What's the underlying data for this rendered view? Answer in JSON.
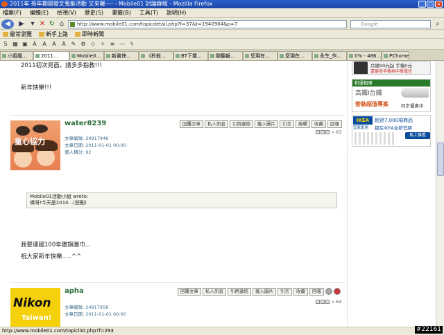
{
  "window": {
    "title": "2011年 新年期間發文蒐集活動 又來囉---- - Mobile01 討論群組 - Mozilla Firefox"
  },
  "menu": [
    "檔案(F)",
    "編輯(E)",
    "檢視(V)",
    "歷史(S)",
    "書籤(B)",
    "工具(T)",
    "說明(H)"
  ],
  "nav": {
    "url": "http://www.mobile01.com/topicdetail.php?f=37&t=1940904&p=7",
    "search_placeholder": "Google"
  },
  "bookmarks": [
    "最常瀏覽",
    "新手上路",
    "即時新聞"
  ],
  "toolbar2": [
    "S",
    "A",
    "A",
    "A",
    "A"
  ],
  "tabs": [
    "小窩魔…",
    "2011…",
    "Mobile0…",
    "新書快…",
    "《秒殺…",
    "BT下載…",
    "閱聽報…",
    "您現在…",
    "您現在…",
    "永生_作…",
    "0% - 486…",
    "PChome…"
  ],
  "post0": {
    "line1": "2011初次見面，請多多指教!!!",
    "line2": "新年快樂!!!"
  },
  "post1": {
    "username": "water8239",
    "avatar_text": "童心協力",
    "meta": [
      "文章編號: 24917946",
      "文章日期: 2011-01-01 00:00",
      "個人積分: 92"
    ],
    "post_no": "63",
    "quote_header": "Mobile01活動小組 wrote:",
    "quote_body": "噴呀!今天是2010...(恕刪)",
    "body1": "我要連國100年鑑旗團巾...",
    "body2": "祝大家新年快樂.....^^"
  },
  "post2": {
    "username": "apha",
    "avatar_text": "Nikon",
    "avatar_sub": "Taiwan!",
    "meta": [
      "文章編號: 24917956",
      "文章日期: 2011-01-01 00:00"
    ],
    "post_no": "64"
  },
  "actions": [
    "回覆文章",
    "私人訊息",
    "引用連結",
    "載入圖片",
    "引言",
    "編輯",
    "收藏",
    "回報"
  ],
  "ads": {
    "ad1_text": "月繳99元起 手機0元",
    "ad1_sub": "寰碁暨手機與中華電信",
    "ad2_brand": "和運租車",
    "ad2_line1": "高鐵Ⅰ台鐵",
    "ad2_line2": "套裝超值專案",
    "ad2_line3": "同步優惠中",
    "ad3_brand": "宜家家居",
    "ad3_line1": "超過7,000項商品",
    "ad3_line2": "都在IKEA全新官網",
    "ad3_button": "馬上搶看"
  },
  "status": "http://www.mobile01.com/topiclist.php?f=293",
  "watermark": "#22161",
  "colors": {
    "username": "#2c6e3a",
    "titlebar": "#2a5fc9"
  }
}
